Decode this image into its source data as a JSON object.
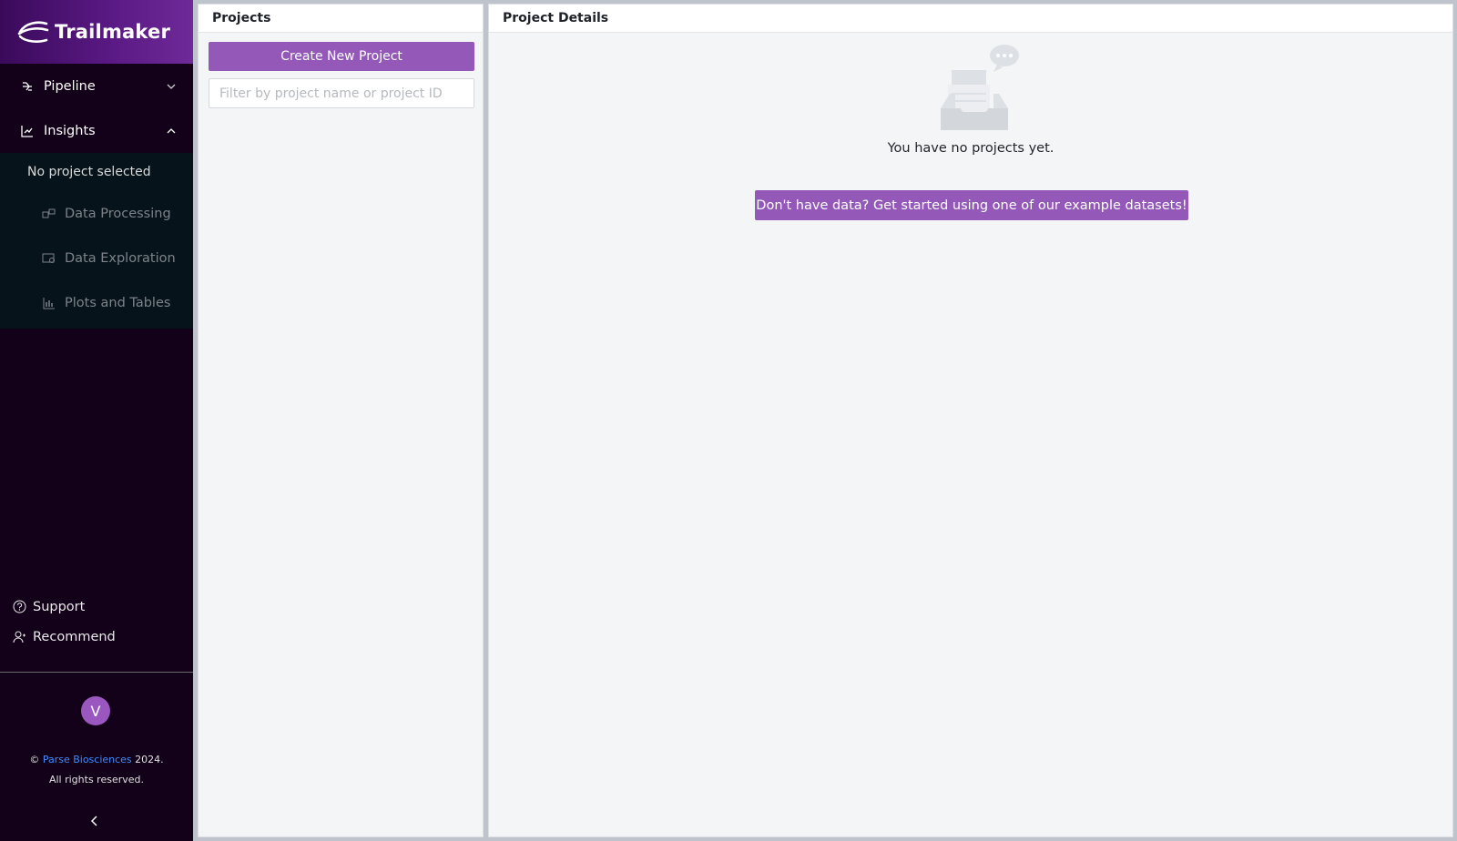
{
  "brand": {
    "name": "Trailmaker"
  },
  "nav": {
    "pipeline": {
      "label": "Pipeline",
      "icon": "pipeline-icon"
    },
    "insights": {
      "label": "Insights",
      "icon": "chart-icon",
      "status": "No project selected",
      "items": [
        {
          "label": "Data Processing",
          "icon": "data-processing-icon"
        },
        {
          "label": "Data Exploration",
          "icon": "data-exploration-icon"
        },
        {
          "label": "Plots and Tables",
          "icon": "bar-chart-icon"
        }
      ]
    }
  },
  "footer_links": {
    "support": "Support",
    "recommend": "Recommend"
  },
  "user": {
    "avatar_letter": "V"
  },
  "copyright": {
    "symbol": "©",
    "company": "Parse Biosciences",
    "year": "2024.",
    "rights": "All rights reserved."
  },
  "projects_panel": {
    "title": "Projects",
    "create_label": "Create New Project",
    "filter_placeholder": "Filter by project name or project ID"
  },
  "details_panel": {
    "title": "Project Details",
    "empty_message": "You have no projects yet.",
    "example_label": "Don't have data? Get started using one of our example datasets!"
  },
  "colors": {
    "sidebar_bg": "#120119",
    "brand_gradient": "#5b1a86",
    "primary_button": "#9459b8",
    "link": "#3f8cff"
  }
}
